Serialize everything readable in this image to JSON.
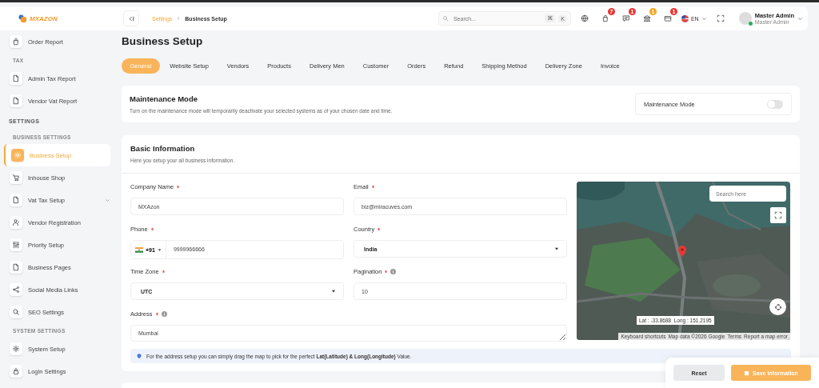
{
  "brand": {
    "name": "MXAZON"
  },
  "sidebar": {
    "items": [
      {
        "kind": "item",
        "label": "Order Report",
        "selected": false
      },
      {
        "kind": "subsection",
        "label": "TAX"
      },
      {
        "kind": "item",
        "label": "Admin Tax Report",
        "selected": false
      },
      {
        "kind": "item",
        "label": "Vendor Vat Report",
        "selected": false
      },
      {
        "kind": "section",
        "label": "SETTINGS"
      },
      {
        "kind": "subsection",
        "label": "BUSINESS SETTINGS"
      },
      {
        "kind": "item",
        "label": "Business Setup",
        "selected": true
      },
      {
        "kind": "item",
        "label": "Inhouse Shop",
        "selected": false
      },
      {
        "kind": "group",
        "label": "Vat Tax Setup",
        "selected": false
      },
      {
        "kind": "item",
        "label": "Vendor Registration",
        "selected": false
      },
      {
        "kind": "item",
        "label": "Priority Setup",
        "selected": false
      },
      {
        "kind": "item",
        "label": "Business Pages",
        "selected": false
      },
      {
        "kind": "item",
        "label": "Social Media Links",
        "selected": false
      },
      {
        "kind": "item",
        "label": "SEO Settings",
        "selected": false
      },
      {
        "kind": "subsection",
        "label": "SYSTEM SETTINGS"
      },
      {
        "kind": "item",
        "label": "System Setup",
        "selected": false
      },
      {
        "kind": "item",
        "label": "Login Settings",
        "selected": false
      }
    ]
  },
  "header": {
    "breadcrumb": [
      "Settings",
      "Business Setup"
    ],
    "search": {
      "placeholder": "Search...",
      "keys": [
        "⌘",
        "K"
      ]
    },
    "notifications": [
      {
        "badge": "7",
        "color": "#e53935"
      },
      {
        "badge": "1",
        "color": "#e53935"
      },
      {
        "badge": "1",
        "color": "#f5a623"
      },
      {
        "badge": "1",
        "color": "#e53935"
      }
    ],
    "language": "EN",
    "user": {
      "name": "Master Admin",
      "role": "Master Admin",
      "online": true
    }
  },
  "page": {
    "title": "Business Setup"
  },
  "tabs": [
    {
      "label": "General",
      "selected": true
    },
    {
      "label": "Website Setup",
      "selected": false
    },
    {
      "label": "Vendors",
      "selected": false
    },
    {
      "label": "Products",
      "selected": false
    },
    {
      "label": "Delivery Men",
      "selected": false
    },
    {
      "label": "Customer",
      "selected": false
    },
    {
      "label": "Orders",
      "selected": false
    },
    {
      "label": "Refund",
      "selected": false
    },
    {
      "label": "Shipping Method",
      "selected": false
    },
    {
      "label": "Delivery Zone",
      "selected": false
    },
    {
      "label": "Invoice",
      "selected": false
    }
  ],
  "maintenance": {
    "title": "Maintenance Mode",
    "description": "Turn on the maintenance mode will temporarily deactivate your selected systems as of your chosen date and time.",
    "toggle_label": "Maintenance Mode",
    "on": false
  },
  "basic_info": {
    "title": "Basic Information",
    "subtitle": "Here you setup your all business information.",
    "fields": [
      {
        "kind": "text",
        "label": "Company Name",
        "required": true,
        "info": false,
        "value": "MXAzon"
      },
      {
        "kind": "text",
        "label": "Email",
        "required": true,
        "info": false,
        "value": "biz@miracuves.com"
      },
      {
        "kind": "phone",
        "label": "Phone",
        "required": true,
        "info": false,
        "code": "+91",
        "value": "9999966666"
      },
      {
        "kind": "select",
        "label": "Country",
        "required": true,
        "info": false,
        "value": "India"
      },
      {
        "kind": "select",
        "label": "Time Zone",
        "required": true,
        "info": false,
        "value": "UTC"
      },
      {
        "kind": "text",
        "label": "Pagination",
        "required": true,
        "info": true,
        "value": "10"
      },
      {
        "kind": "textarea",
        "label": "Address",
        "required": true,
        "info": true,
        "value": "Mumbai"
      }
    ],
    "map": {
      "kind": "picture",
      "search_placeholder": "Search here",
      "coordinates": "Lat : -33.8688  Long : 151.2195",
      "attribution": [
        "Keyboard shortcuts",
        "Map data ©2026 Google",
        "Terms",
        "Report a map error"
      ]
    },
    "hint": "For the address setup you can simply drag the map to pick for the perfect **Lat(Latitude) & Long(Longitude)** Value."
  },
  "actions": {
    "reset": "Reset",
    "save": "Save information"
  }
}
